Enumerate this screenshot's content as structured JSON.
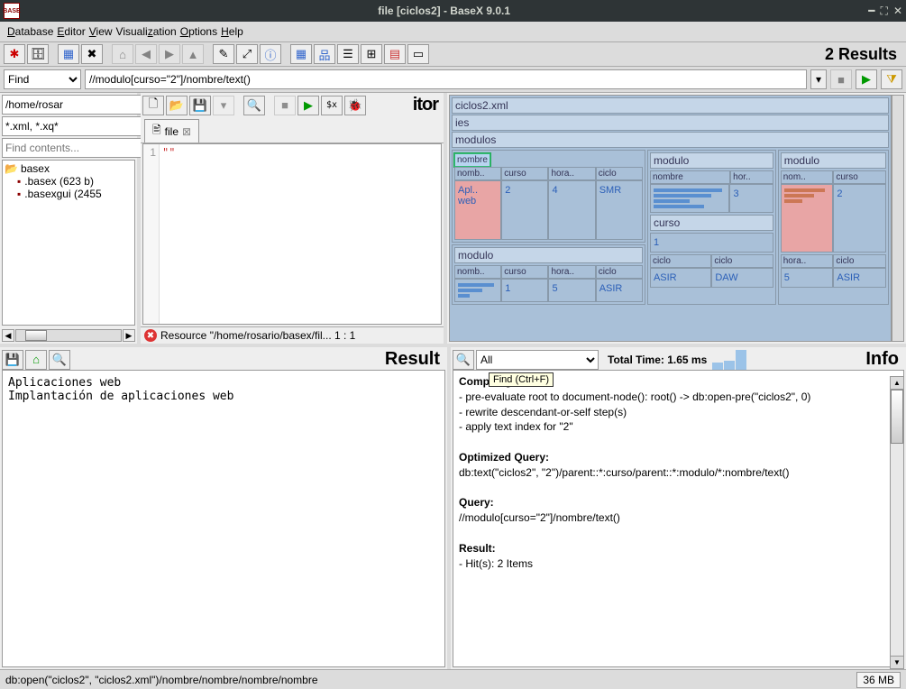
{
  "title": "file [ciclos2] - BaseX 9.0.1",
  "app_icon_text": "BASE",
  "menu": {
    "database": "Database",
    "editor": "Editor",
    "view": "View",
    "visualization": "Visualization",
    "options": "Options",
    "help": "Help"
  },
  "results_label": "2 Results",
  "search": {
    "mode": "Find",
    "query": "//modulo[curso=\"2\"]/nombre/text()"
  },
  "project": {
    "path": "/home/rosar",
    "filter_ext": "*.xml, *.xq*",
    "find_contents": "Find contents...",
    "folder": "basex",
    "files": [
      {
        "name": ".basex (623 b)"
      },
      {
        "name": ".basexgui (2455"
      }
    ]
  },
  "editor": {
    "title": "itor",
    "tab": "file",
    "line_no": "1",
    "code": "\"\"",
    "error": "Resource \"/home/rosario/basex/fil...  1 : 1"
  },
  "map": {
    "file": "ciclos2.xml",
    "root": "ies",
    "group": "modulos",
    "selected": "nombre",
    "cols": [
      "nomb..",
      "curso",
      "hora..",
      "ciclo"
    ],
    "m1": {
      "nombre": "Apl.. web",
      "curso": "2",
      "hora": "4",
      "ciclo": "SMR"
    },
    "m2": {
      "curso": "1",
      "hora": "5",
      "ciclo": "ASIR"
    },
    "m3_label": "modulo",
    "m3_nombre": "nombre",
    "m3_hor": "hor..",
    "m3_hora": "3",
    "m3_curso_label": "curso",
    "m3_curso": "1",
    "m3_c1": "ciclo",
    "m3_c1v": "ASIR",
    "m3_c2": "ciclo",
    "m3_c2v": "DAW",
    "m4_label": "modulo",
    "m4_cols": [
      "nom..",
      "curso"
    ],
    "m4_curso": "2",
    "m4_hora_l": "hora..",
    "m4_hora": "5",
    "m4_ciclo_l": "ciclo",
    "m4_ciclo": "ASIR",
    "modulo_label": "modulo"
  },
  "result": {
    "title": "Result",
    "lines": "Aplicaciones web\nImplantación de aplicaciones web"
  },
  "info": {
    "title": "Info",
    "filter": "All",
    "total_time": "Total Time: 1.65 ms",
    "tooltip": "Find (Ctrl+F)",
    "compiling_h": "Compiling:",
    "compiling_1": "- pre-evaluate root to document-node(): root() -> db:open-pre(\"ciclos2\", 0)",
    "compiling_2": "- rewrite descendant-or-self step(s)",
    "compiling_3": "- apply text index for \"2\"",
    "opt_h": "Optimized Query:",
    "opt_body": "db:text(\"ciclos2\", \"2\")/parent::*:curso/parent::*:modulo/*:nombre/text()",
    "query_h": "Query:",
    "query_body": "//modulo[curso=\"2\"]/nombre/text()",
    "result_h": "Result:",
    "result_body": "- Hit(s): 2 Items"
  },
  "statusbar": {
    "path": "db:open(\"ciclos2\", \"ciclos2.xml\")/nombre/nombre/nombre/nombre",
    "mem": "36 MB"
  }
}
